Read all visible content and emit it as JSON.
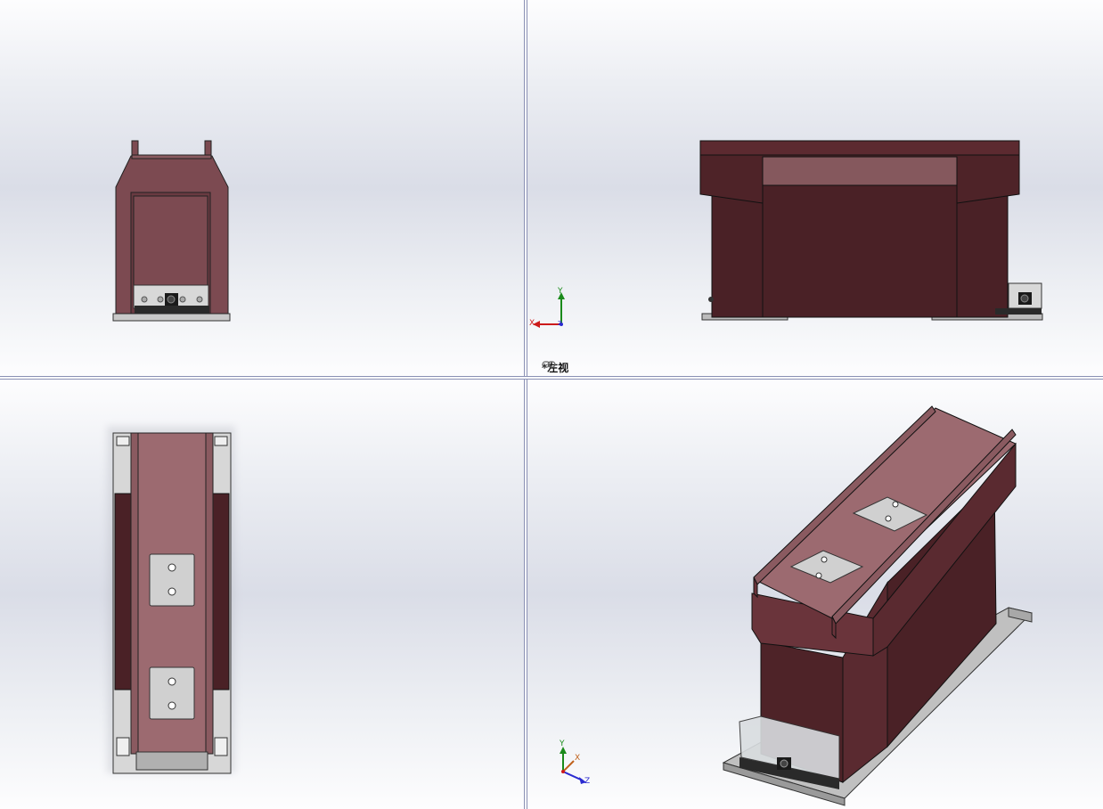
{
  "viewports": {
    "front": {
      "name": "front-view"
    },
    "left": {
      "name": "left-view",
      "label": "*左视",
      "triad_x": "X",
      "triad_y": "Y",
      "triad_z": "Z"
    },
    "top": {
      "name": "top-view"
    },
    "iso": {
      "name": "isometric-view",
      "triad_x": "X",
      "triad_y": "Y",
      "triad_z": "Z"
    }
  },
  "icons": {
    "link": "link-icon"
  },
  "colors": {
    "body_dark": "#4a2126",
    "body_mid": "#7c4a51",
    "body_light": "#9c6a70",
    "plate": "#c8c8c8",
    "viewport_border": "#8a90b4"
  }
}
